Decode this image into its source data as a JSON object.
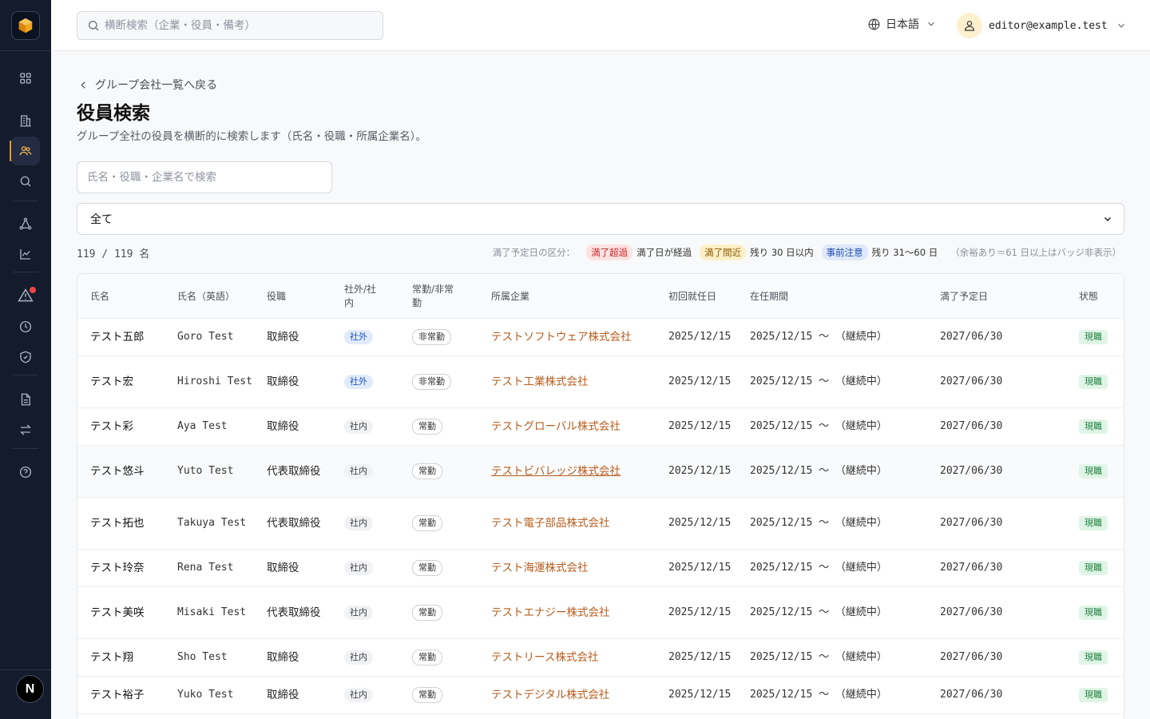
{
  "search": {
    "placeholder": "横断検索（企業・役員・備考）"
  },
  "header": {
    "language": "日本語",
    "user_email": "editor@example.test"
  },
  "sidebar": {
    "nav": [
      "dashboard-icon",
      "building-icon",
      "users-icon",
      "search-icon",
      "network-icon",
      "chart-icon",
      "alert-icon",
      "clock-icon",
      "shield-icon",
      "document-icon",
      "swap-icon",
      "help-icon"
    ],
    "footer_badge": "N",
    "accent": "#e39b26"
  },
  "page": {
    "back_link": "グループ会社一覧へ戻る",
    "title": "役員検索",
    "description": "グループ全社の役員を横断的に検索します（氏名・役職・所属企業名）。",
    "filter_placeholder": "氏名・役職・企業名で検索",
    "filter_select": "全て",
    "count": "119 / 119 名"
  },
  "legend": {
    "label": "満了予定日の区分：",
    "items": [
      {
        "badge": "満了超過",
        "text": "満了日が経過"
      },
      {
        "badge": "満了間近",
        "text": "残り 30 日以内"
      },
      {
        "badge": "事前注意",
        "text": "残り 31〜60 日"
      }
    ],
    "note": "（余裕あり＝61 日以上はバッジ非表示）"
  },
  "table": {
    "headers": [
      "氏名",
      "氏名（英語）",
      "役職",
      "社外/社内",
      "常勤/非常勤",
      "所属企業",
      "初回就任日",
      "在任期間",
      "満了予定日",
      "状態"
    ],
    "rows": [
      {
        "name": "テスト五郎",
        "name_en": "Goro Test",
        "title": "取締役",
        "inout": "社外",
        "ft": "非常勤",
        "company": "テストソフトウェア株式会社",
        "first": "2025/12/15",
        "term": "2025/12/15 〜 （継続中）",
        "expiry": "2027/06/30",
        "status": "現職"
      },
      {
        "name": "テスト宏",
        "name_en": "Hiroshi Test",
        "title": "取締役",
        "inout": "社外",
        "ft": "非常勤",
        "company": "テスト工業株式会社",
        "first": "2025/12/15",
        "term": "2025/12/15 〜 （継続中）",
        "expiry": "2027/06/30",
        "status": "現職"
      },
      {
        "name": "テスト彩",
        "name_en": "Aya Test",
        "title": "取締役",
        "inout": "社内",
        "ft": "常勤",
        "company": "テストグローバル株式会社",
        "first": "2025/12/15",
        "term": "2025/12/15 〜 （継続中）",
        "expiry": "2027/06/30",
        "status": "現職"
      },
      {
        "name": "テスト悠斗",
        "name_en": "Yuto Test",
        "title": "代表取締役",
        "inout": "社内",
        "ft": "常勤",
        "company": "テストビバレッジ株式会社",
        "first": "2025/12/15",
        "term": "2025/12/15 〜 （継続中）",
        "expiry": "2027/06/30",
        "status": "現職"
      },
      {
        "name": "テスト拓也",
        "name_en": "Takuya Test",
        "title": "代表取締役",
        "inout": "社内",
        "ft": "常勤",
        "company": "テスト電子部品株式会社",
        "first": "2025/12/15",
        "term": "2025/12/15 〜 （継続中）",
        "expiry": "2027/06/30",
        "status": "現職"
      },
      {
        "name": "テスト玲奈",
        "name_en": "Rena Test",
        "title": "取締役",
        "inout": "社内",
        "ft": "常勤",
        "company": "テスト海運株式会社",
        "first": "2025/12/15",
        "term": "2025/12/15 〜 （継続中）",
        "expiry": "2027/06/30",
        "status": "現職"
      },
      {
        "name": "テスト美咲",
        "name_en": "Misaki Test",
        "title": "代表取締役",
        "inout": "社内",
        "ft": "常勤",
        "company": "テストエナジー株式会社",
        "first": "2025/12/15",
        "term": "2025/12/15 〜 （継続中）",
        "expiry": "2027/06/30",
        "status": "現職"
      },
      {
        "name": "テスト翔",
        "name_en": "Sho Test",
        "title": "取締役",
        "inout": "社内",
        "ft": "常勤",
        "company": "テストリース株式会社",
        "first": "2025/12/15",
        "term": "2025/12/15 〜 （継続中）",
        "expiry": "2027/06/30",
        "status": "現職"
      },
      {
        "name": "テスト裕子",
        "name_en": "Yuko Test",
        "title": "取締役",
        "inout": "社内",
        "ft": "常勤",
        "company": "テストデジタル株式会社",
        "first": "2025/12/15",
        "term": "2025/12/15 〜 （継続中）",
        "expiry": "2027/06/30",
        "status": "現職"
      }
    ]
  }
}
